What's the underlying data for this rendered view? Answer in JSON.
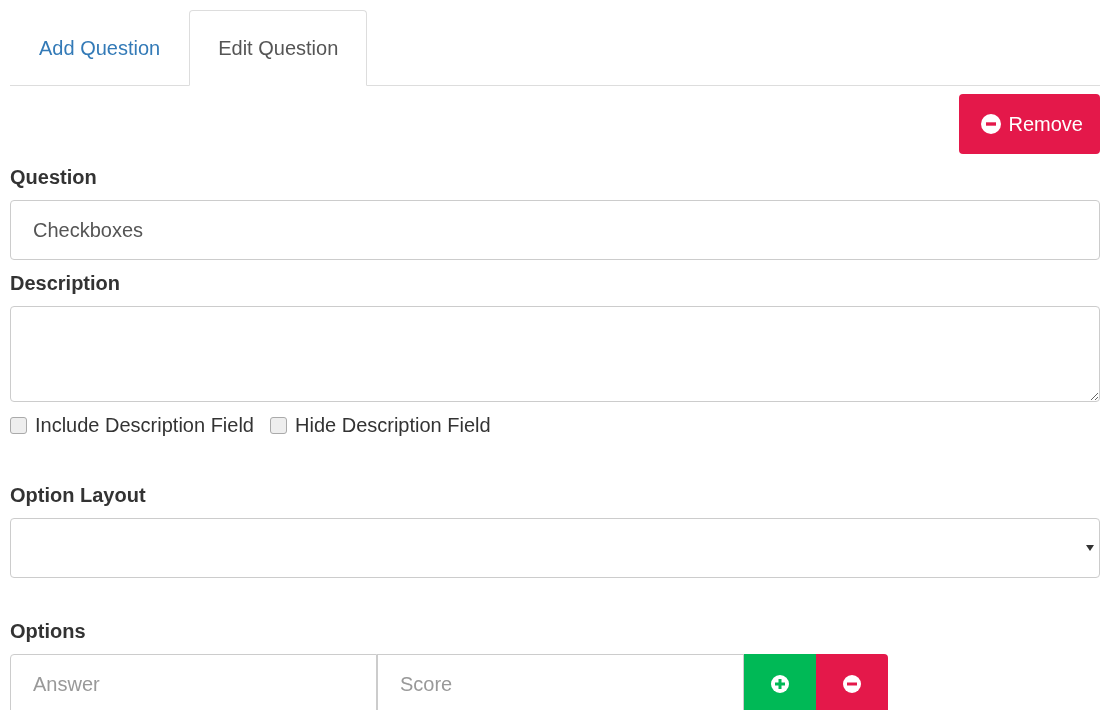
{
  "tabs": [
    {
      "label": "Add Question",
      "selected": false
    },
    {
      "label": "Edit Question",
      "selected": true
    }
  ],
  "remove_button": {
    "label": "Remove"
  },
  "question": {
    "label": "Question",
    "value": "Checkboxes"
  },
  "description": {
    "label": "Description"
  },
  "checkboxes": [
    {
      "label": "Include Description Field",
      "checked": false
    },
    {
      "label": "Hide Description Field",
      "checked": false
    }
  ],
  "option_layout": {
    "label": "Option Layout"
  },
  "options": {
    "label": "Options",
    "answer_placeholder": "Answer",
    "score_placeholder": "Score"
  }
}
